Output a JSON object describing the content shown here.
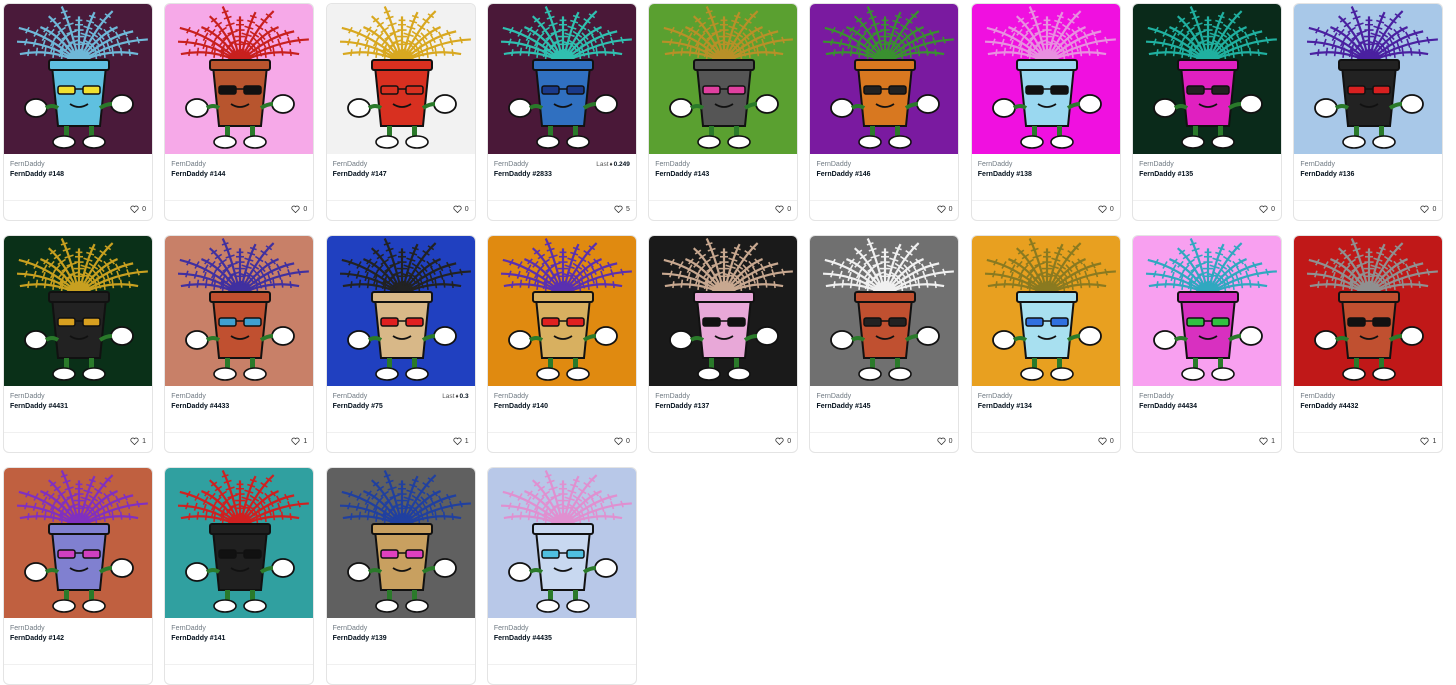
{
  "items": [
    {
      "collection": "FernDaddy",
      "name": "FernDaddy #148",
      "likes": "0",
      "last": "",
      "last_label": "",
      "bg": "#4a1a3a",
      "fern": "#6fb8d8",
      "pot": "#5fc0e0",
      "glasses": "#f0e030"
    },
    {
      "collection": "FernDaddy",
      "name": "FernDaddy #144",
      "likes": "0",
      "last": "",
      "last_label": "",
      "bg": "#f6a9e8",
      "fern": "#c8201e",
      "pot": "#b8552e",
      "glasses": "#111111"
    },
    {
      "collection": "FernDaddy",
      "name": "FernDaddy #147",
      "likes": "0",
      "last": "",
      "last_label": "",
      "bg": "#f2f2f2",
      "fern": "#d8a820",
      "pot": "#d83020",
      "glasses": "#d83020"
    },
    {
      "collection": "FernDaddy",
      "name": "FernDaddy #2833",
      "likes": "5",
      "last": "0.249",
      "last_label": "Last",
      "bg": "#4a1838",
      "fern": "#30c0b0",
      "pot": "#3070c0",
      "glasses": "#1a3a8a"
    },
    {
      "collection": "FernDaddy",
      "name": "FernDaddy #143",
      "likes": "0",
      "last": "",
      "last_label": "",
      "bg": "#5aa030",
      "fern": "#b89028",
      "pot": "#555555",
      "glasses": "#e040a0"
    },
    {
      "collection": "FernDaddy",
      "name": "FernDaddy #146",
      "likes": "0",
      "last": "",
      "last_label": "",
      "bg": "#7a1aa0",
      "fern": "#3a9030",
      "pot": "#d87820",
      "glasses": "#222222"
    },
    {
      "collection": "FernDaddy",
      "name": "FernDaddy #138",
      "likes": "0",
      "last": "",
      "last_label": "",
      "bg": "#f010e0",
      "fern": "#e890e0",
      "pot": "#9ad8f0",
      "glasses": "#111111"
    },
    {
      "collection": "FernDaddy",
      "name": "FernDaddy #135",
      "likes": "0",
      "last": "",
      "last_label": "",
      "bg": "#0a2a1a",
      "fern": "#20b0a0",
      "pot": "#e020c0",
      "glasses": "#222222"
    },
    {
      "collection": "FernDaddy",
      "name": "FernDaddy #136",
      "likes": "0",
      "last": "",
      "last_label": "",
      "bg": "#a8c8e8",
      "fern": "#4a20a0",
      "pot": "#222222",
      "glasses": "#d82020"
    },
    {
      "collection": "FernDaddy",
      "name": "FernDaddy #4431",
      "likes": "1",
      "last": "",
      "last_label": "",
      "bg": "#0a3018",
      "fern": "#c8a020",
      "pot": "#222222",
      "glasses": "#d8a020"
    },
    {
      "collection": "FernDaddy",
      "name": "FernDaddy #4433",
      "likes": "1",
      "last": "",
      "last_label": "",
      "bg": "#c88068",
      "fern": "#4030a0",
      "pot": "#c05030",
      "glasses": "#40a0d0"
    },
    {
      "collection": "FernDaddy",
      "name": "FernDaddy #75",
      "likes": "1",
      "last": "0.3",
      "last_label": "Last",
      "bg": "#2040c0",
      "fern": "#222222",
      "pot": "#d8b888",
      "glasses": "#e02020"
    },
    {
      "collection": "FernDaddy",
      "name": "FernDaddy #140",
      "likes": "0",
      "last": "",
      "last_label": "",
      "bg": "#e08a10",
      "fern": "#5a30b0",
      "pot": "#d8b060",
      "glasses": "#e02020"
    },
    {
      "collection": "FernDaddy",
      "name": "FernDaddy #137",
      "likes": "0",
      "last": "",
      "last_label": "",
      "bg": "#1a1a1a",
      "fern": "#c8a890",
      "pot": "#e8a8d8",
      "glasses": "#111111"
    },
    {
      "collection": "FernDaddy",
      "name": "FernDaddy #145",
      "likes": "0",
      "last": "",
      "last_label": "",
      "bg": "#707070",
      "fern": "#f0f0f0",
      "pot": "#c05030",
      "glasses": "#222222"
    },
    {
      "collection": "FernDaddy",
      "name": "FernDaddy #134",
      "likes": "0",
      "last": "",
      "last_label": "",
      "bg": "#e8a020",
      "fern": "#8a7a20",
      "pot": "#a8e0f0",
      "glasses": "#3070e0"
    },
    {
      "collection": "FernDaddy",
      "name": "FernDaddy #4434",
      "likes": "1",
      "last": "",
      "last_label": "",
      "bg": "#f8a0f0",
      "fern": "#30a8c0",
      "pot": "#d830c0",
      "glasses": "#30c040"
    },
    {
      "collection": "FernDaddy",
      "name": "FernDaddy #4432",
      "likes": "1",
      "last": "",
      "last_label": "",
      "bg": "#c01818",
      "fern": "#909090",
      "pot": "#c05030",
      "glasses": "#111111"
    },
    {
      "collection": "FernDaddy",
      "name": "FernDaddy #142",
      "likes": "",
      "last": "",
      "last_label": "",
      "bg": "#c06040",
      "fern": "#8030c0",
      "pot": "#8080d0",
      "glasses": "#d040c0"
    },
    {
      "collection": "FernDaddy",
      "name": "FernDaddy #141",
      "likes": "",
      "last": "",
      "last_label": "",
      "bg": "#30a0a0",
      "fern": "#d02020",
      "pot": "#202020",
      "glasses": "#111111"
    },
    {
      "collection": "FernDaddy",
      "name": "FernDaddy #139",
      "likes": "",
      "last": "",
      "last_label": "",
      "bg": "#606060",
      "fern": "#2040a0",
      "pot": "#c8a060",
      "glasses": "#e040c0"
    },
    {
      "collection": "FernDaddy",
      "name": "FernDaddy #4435",
      "likes": "",
      "last": "",
      "last_label": "",
      "bg": "#b8c8e8",
      "fern": "#e090d0",
      "pot": "#c8d8f0",
      "glasses": "#50c0e0"
    }
  ]
}
